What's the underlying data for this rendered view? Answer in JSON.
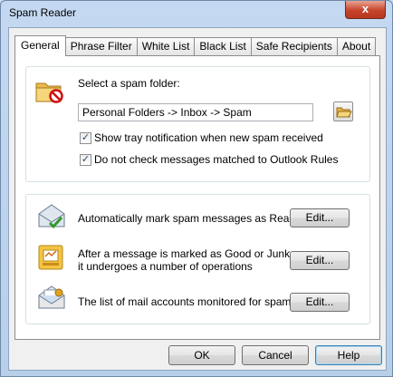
{
  "window": {
    "title": "Spam Reader",
    "close_glyph": "x"
  },
  "tabs": [
    {
      "label": "General",
      "active": true
    },
    {
      "label": "Phrase Filter"
    },
    {
      "label": "White List"
    },
    {
      "label": "Black List"
    },
    {
      "label": "Safe Recipients"
    },
    {
      "label": "About"
    }
  ],
  "general": {
    "select_folder_label": "Select a spam folder:",
    "folder_path": "Personal Folders -> Inbox -> Spam",
    "show_tray_label": "Show tray notification when new spam received",
    "show_tray_checked": true,
    "no_check_rules_label": "Do not check messages matched to Outlook Rules",
    "no_check_rules_checked": true
  },
  "actions": [
    {
      "text": "Automatically mark spam messages as Read",
      "button": "Edit..."
    },
    {
      "text_line1": "After a message is marked as Good or Junk",
      "text_line2": "it undergoes a number of operations",
      "button": "Edit..."
    },
    {
      "text": "The list of mail accounts monitored for spam",
      "button": "Edit..."
    }
  ],
  "buttons": {
    "ok": "OK",
    "cancel": "Cancel",
    "help": "Help"
  }
}
